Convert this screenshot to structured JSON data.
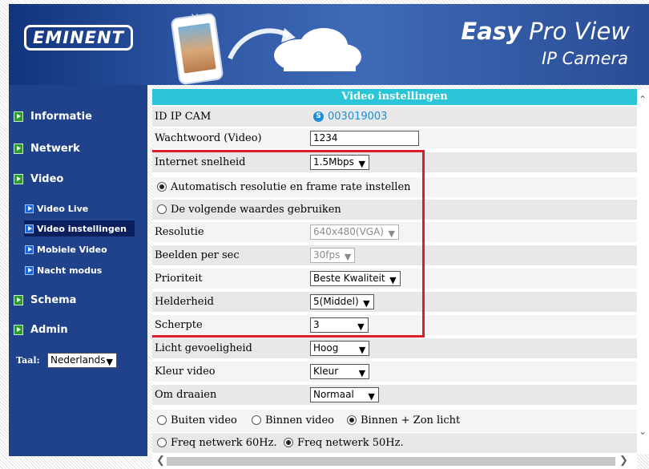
{
  "header": {
    "logo_text": "EMINENT",
    "brand_title_bold": "Easy",
    "brand_title_rest": " Pro View",
    "brand_subtitle": "IP Camera"
  },
  "sidebar": {
    "main_items": [
      {
        "label": "Informatie"
      },
      {
        "label": "Netwerk"
      },
      {
        "label": "Video"
      },
      {
        "label": "Schema"
      },
      {
        "label": "Admin"
      }
    ],
    "video_subitems": [
      {
        "label": "Video Live",
        "active": false
      },
      {
        "label": "Video instellingen",
        "active": true
      },
      {
        "label": "Mobiele Video",
        "active": false
      },
      {
        "label": "Nacht modus",
        "active": false
      }
    ],
    "language_label": "Taal:",
    "language_value": "Nederlands"
  },
  "main": {
    "title": "Video instellingen",
    "rows": {
      "id_label": "ID IP CAM",
      "id_value": "003019003",
      "password_label": "Wachtwoord (Video)",
      "password_value": "1234",
      "internet_label": "Internet snelheid",
      "internet_value": "1.5Mbps",
      "auto_option": "Automatisch resolutie en frame rate instellen",
      "auto_selected": true,
      "manual_option": "De volgende waardes gebruiken",
      "resolution_label": "Resolutie",
      "resolution_value": "640x480(VGA)",
      "fps_label": "Beelden per sec",
      "fps_value": "30fps",
      "priority_label": "Prioriteit",
      "priority_value": "Beste Kwaliteit",
      "brightness_label": "Helderheid",
      "brightness_value": "5(Middel)",
      "sharpness_label": "Scherpte",
      "sharpness_value": "3",
      "light_label": "Licht gevoeligheid",
      "light_value": "Hoog",
      "color_label": "Kleur video",
      "color_value": "Kleur",
      "rotate_label": "Om draaien",
      "rotate_value": "Normaal",
      "env_outdoor": "Buiten video",
      "env_indoor": "Binnen video",
      "env_mixed": "Binnen + Zon licht",
      "env_selected": "mixed",
      "freq_60": "Freq netwerk 60Hz.",
      "freq_50": "Freq netwerk 50Hz.",
      "freq_selected": "50"
    }
  },
  "colors": {
    "header_blue": "#2f57a4",
    "sidebar_blue": "#1f428a",
    "title_cyan": "#2ac6d8",
    "highlight_red": "#d9202a",
    "camera_id_blue": "#1a8fd6"
  }
}
